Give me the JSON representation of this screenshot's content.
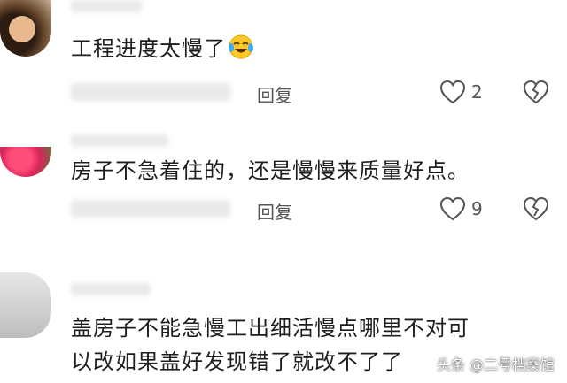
{
  "comments": [
    {
      "text": "工程进度太慢了",
      "reply_label": "回复",
      "likes": "2"
    },
    {
      "text": "房子不急着住的，还是慢慢来质量好点。",
      "reply_label": "回复",
      "likes": "9"
    },
    {
      "text_line1": "盖房子不能急慢工出细活慢点哪里不对可",
      "text_line2": "以改如果盖好发现错了就改不了了"
    }
  ],
  "watermark": "头条 @二号档案馆",
  "colors": {
    "text": "#1e1e1e",
    "meta": "#555555",
    "background": "#ffffff"
  }
}
